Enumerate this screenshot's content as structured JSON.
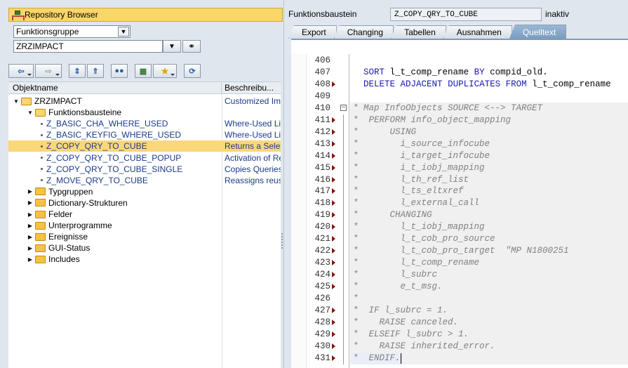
{
  "left": {
    "header": {
      "title": "Repository Browser",
      "icon": "tree-icon"
    },
    "object_type_select": {
      "value": "Funktionsgruppe"
    },
    "object_name_input": {
      "value": "ZRZIMPACT"
    },
    "tree_columns": {
      "name": "Objektname",
      "description": "Beschreibu..."
    },
    "tree": [
      {
        "level": 0,
        "kind": "folder-open",
        "expander": "▼",
        "name": "ZRZIMPACT",
        "desc": "Customized Imp"
      },
      {
        "level": 1,
        "kind": "folder-open",
        "expander": "▼",
        "name": "Funktionsbausteine",
        "desc": ""
      },
      {
        "level": 2,
        "kind": "fb",
        "name": "Z_BASIC_CHA_WHERE_USED",
        "desc": "Where-Used Lis"
      },
      {
        "level": 2,
        "kind": "fb",
        "name": "Z_BASIC_KEYFIG_WHERE_USED",
        "desc": "Where-Used Lis"
      },
      {
        "level": 2,
        "kind": "fb",
        "name": "Z_COPY_QRY_TO_CUBE",
        "desc": "Returns a Selec",
        "selected": true
      },
      {
        "level": 2,
        "kind": "fb",
        "name": "Z_COPY_QRY_TO_CUBE_POPUP",
        "desc": "Activation of Re"
      },
      {
        "level": 2,
        "kind": "fb",
        "name": "Z_COPY_QRY_TO_CUBE_SINGLE",
        "desc": "Copies Queries"
      },
      {
        "level": 2,
        "kind": "fb",
        "name": "Z_MOVE_QRY_TO_CUBE",
        "desc": "Reassigns reusa"
      },
      {
        "level": 1,
        "kind": "folder",
        "expander": "▶",
        "name": "Typgruppen",
        "desc": ""
      },
      {
        "level": 1,
        "kind": "folder",
        "expander": "▶",
        "name": "Dictionary-Strukturen",
        "desc": ""
      },
      {
        "level": 1,
        "kind": "folder",
        "expander": "▶",
        "name": "Felder",
        "desc": ""
      },
      {
        "level": 1,
        "kind": "folder",
        "expander": "▶",
        "name": "Unterprogramme",
        "desc": ""
      },
      {
        "level": 1,
        "kind": "folder",
        "expander": "▶",
        "name": "Ereignisse",
        "desc": ""
      },
      {
        "level": 1,
        "kind": "folder",
        "expander": "▶",
        "name": "GUI-Status",
        "desc": ""
      },
      {
        "level": 1,
        "kind": "folder",
        "expander": "▶",
        "name": "Includes",
        "desc": ""
      }
    ]
  },
  "right": {
    "fb_label": "Funktionsbaustein",
    "fb_name": "Z_COPY_QRY_TO_CUBE",
    "fb_status": "inaktiv",
    "tabs": [
      {
        "label": "Export",
        "active": false
      },
      {
        "label": "Changing",
        "active": false
      },
      {
        "label": "Tabellen",
        "active": false
      },
      {
        "label": "Ausnahmen",
        "active": false
      },
      {
        "label": "Quelltext",
        "active": true
      }
    ],
    "code_lines": [
      {
        "n": "406",
        "code": "",
        "type": "blank"
      },
      {
        "n": "407",
        "code": "  SORT l_t_comp_rename BY compid_old.",
        "type": "code"
      },
      {
        "n": "408",
        "code": "  DELETE ADJACENT DUPLICATES FROM l_t_comp_rename",
        "type": "code",
        "mark": true
      },
      {
        "n": "409",
        "code": "",
        "type": "blank"
      },
      {
        "n": "410",
        "code": "* Map InfoObjects SOURCE <--> TARGET",
        "type": "comment",
        "fold": true
      },
      {
        "n": "411",
        "code": "*  PERFORM info_object_mapping",
        "type": "comment",
        "mark": true
      },
      {
        "n": "412",
        "code": "*      USING",
        "type": "comment",
        "mark": true
      },
      {
        "n": "413",
        "code": "*        i_source_infocube",
        "type": "comment",
        "mark": true
      },
      {
        "n": "414",
        "code": "*        i_target_infocube",
        "type": "comment",
        "mark": true
      },
      {
        "n": "415",
        "code": "*        i_t_iobj_mapping",
        "type": "comment",
        "mark": true
      },
      {
        "n": "416",
        "code": "*        l_th_ref_list",
        "type": "comment",
        "mark": true
      },
      {
        "n": "417",
        "code": "*        l_ts_eltxref",
        "type": "comment",
        "mark": true
      },
      {
        "n": "418",
        "code": "*        l_external_call",
        "type": "comment",
        "mark": true
      },
      {
        "n": "419",
        "code": "*      CHANGING",
        "type": "comment",
        "mark": true
      },
      {
        "n": "420",
        "code": "*        l_t_iobj_mapping",
        "type": "comment",
        "mark": true
      },
      {
        "n": "421",
        "code": "*        l_t_cob_pro_source",
        "type": "comment",
        "mark": true
      },
      {
        "n": "422",
        "code": "*        l_t_cob_pro_target  \"MP N1800251",
        "type": "comment",
        "mark": true
      },
      {
        "n": "423",
        "code": "*        l_t_comp_rename",
        "type": "comment",
        "mark": true
      },
      {
        "n": "424",
        "code": "*        l_subrc",
        "type": "comment",
        "mark": true
      },
      {
        "n": "425",
        "code": "*        e_t_msg.",
        "type": "comment",
        "mark": true
      },
      {
        "n": "426",
        "code": "*",
        "type": "comment"
      },
      {
        "n": "427",
        "code": "*  IF l_subrc = 1.",
        "type": "comment",
        "mark": true
      },
      {
        "n": "428",
        "code": "*    RAISE canceled.",
        "type": "comment",
        "mark": true
      },
      {
        "n": "429",
        "code": "*  ELSEIF l_subrc > 1.",
        "type": "comment",
        "mark": true
      },
      {
        "n": "430",
        "code": "*    RAISE inherited_error.",
        "type": "comment",
        "mark": true
      },
      {
        "n": "431",
        "code": "*  ENDIF.",
        "type": "comment",
        "mark": true,
        "cursor": true
      }
    ]
  }
}
